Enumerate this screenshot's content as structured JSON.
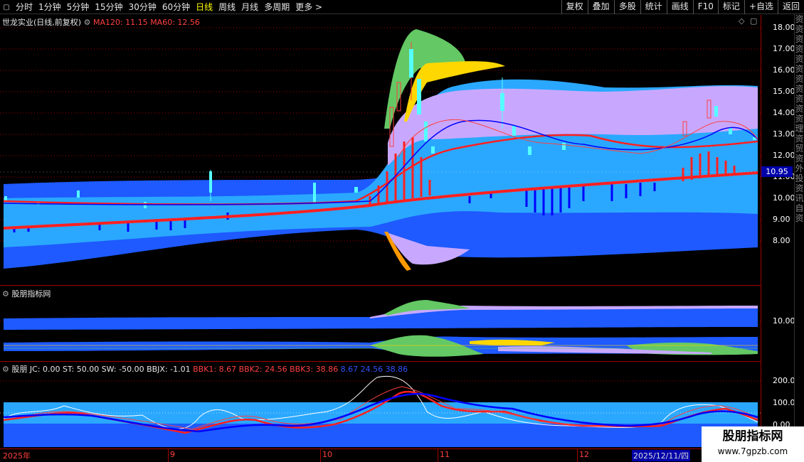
{
  "toolbar": {
    "periods": [
      "分时",
      "1分钟",
      "5分钟",
      "15分钟",
      "30分钟",
      "60分钟",
      "日线",
      "周线",
      "月线",
      "多周期",
      "更多"
    ],
    "active_period": "日线",
    "right_buttons": [
      "复权",
      "叠加",
      "多股",
      "统计",
      "画线",
      "F10",
      "标记",
      "+自选",
      "返回"
    ]
  },
  "main_panel": {
    "title": "世龙实业(日线,前复权)",
    "ma120_label": "MA120: 11.15",
    "ma60_label": "MA60: 12.56",
    "y_axis": [
      "18.00",
      "17.00",
      "16.00",
      "15.00",
      "14.00",
      "13.00",
      "12.00",
      "11.00",
      "10.00",
      "9.00",
      "8.00"
    ],
    "current_price": "10.95"
  },
  "indicator_panel": {
    "title": "股朋指标网",
    "y_axis": [
      "10.00"
    ]
  },
  "osc_panel": {
    "name": "股朋",
    "jc": "JC: 0.00",
    "st": "ST: 50.00",
    "sw": "SW: -50.00",
    "bbjx": "BBJX: -1.01",
    "bbk1": "BBK1: 8.67",
    "bbk2": "BBK2: 24.56",
    "bbk3": "BBK3: 38.86",
    "repeat": "8.67  24.56  38.86",
    "y_axis": [
      "200.0",
      "100.0",
      "0.00"
    ]
  },
  "date_axis": {
    "labels": [
      "2025年",
      "9",
      "10",
      "11",
      "12"
    ],
    "current": "2025/12/11/四"
  },
  "right_strip": [
    "资",
    "资",
    "资",
    "资",
    "资",
    "资",
    "资",
    "资",
    "资",
    "资",
    "资",
    "理",
    "资",
    "贸",
    "资",
    "外",
    "投",
    "资",
    "讯",
    "自",
    "资"
  ],
  "watermark": {
    "title": "股朋指标网",
    "url": "www.7gpzb.com"
  },
  "colors": {
    "background": "#000000",
    "grid_red": "#a00000",
    "ma_red": "#ff2020",
    "ma_blue": "#0000ff",
    "band_dark": "#1e5aff",
    "band_light": "#2aa8ff",
    "band_lavender": "#c8a8ff",
    "band_green": "#64c864",
    "band_yellow": "#ffd700",
    "candle_up": "#ff4040",
    "candle_down": "#5ff",
    "accent_yellow": "#ffff00"
  }
}
